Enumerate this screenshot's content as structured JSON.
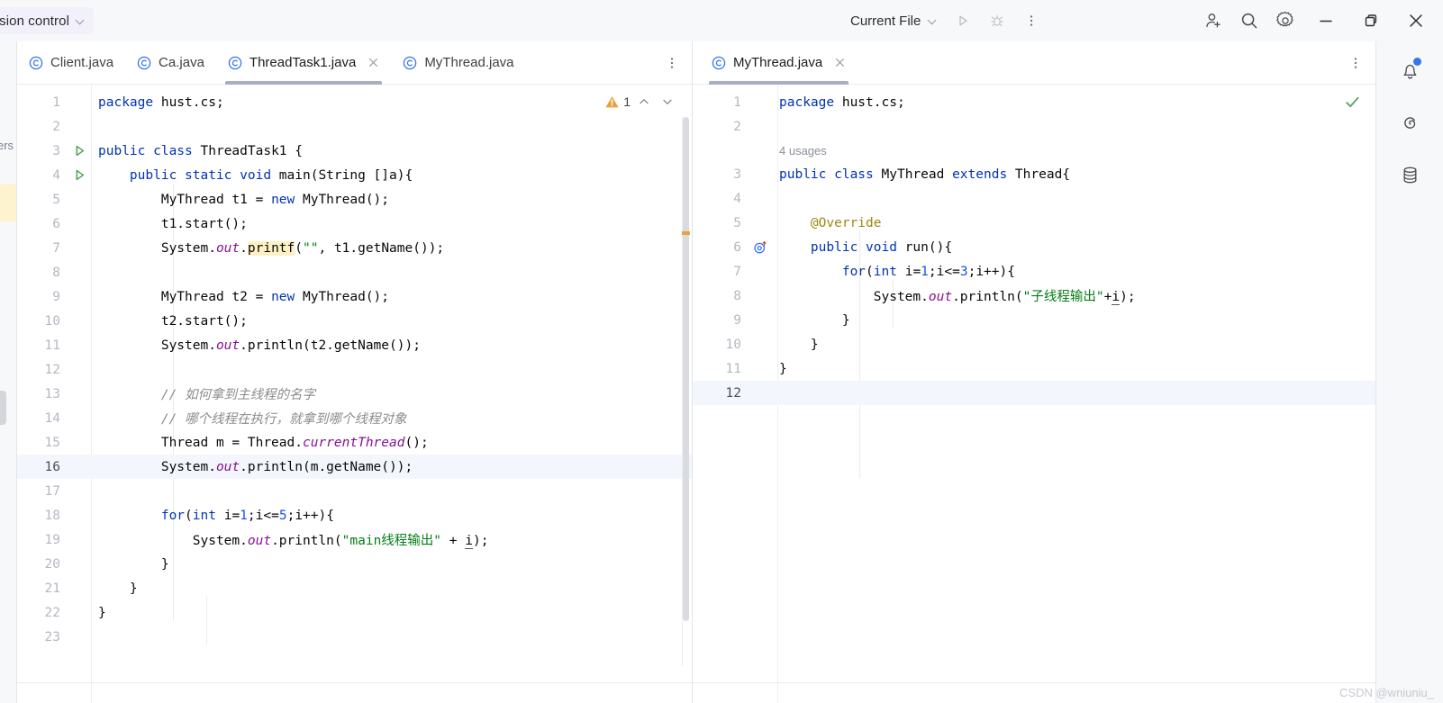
{
  "header": {
    "vcs_label": "rsion control",
    "vcs_chevron_icon": "chevron-down-icon",
    "run_config_label": "Current File",
    "run_config_chevron_icon": "chevron-down-icon",
    "run_icon": "run-play-icon",
    "debug_icon": "debug-bug-icon",
    "more_icon": "more-vertical-icon",
    "add_user_icon": "add-user-icon",
    "search_icon": "search-icon",
    "settings_icon": "gear-icon",
    "minimize_icon": "minimize-icon",
    "maximize_icon": "restore-icon",
    "close_icon": "close-icon"
  },
  "left_stripe": {
    "label": "ers",
    "marker_color": "#fdf3cf"
  },
  "right_stripe": {
    "items": [
      {
        "icon": "notifications-bell-icon",
        "badge": true
      },
      {
        "icon": "ai-assistant-spiral-icon",
        "badge": false
      },
      {
        "icon": "database-icon",
        "badge": false
      }
    ]
  },
  "left_pane": {
    "tabs": [
      {
        "label": "Client.java",
        "icon": "java-class-icon",
        "active": false,
        "closable": false
      },
      {
        "label": "Ca.java",
        "icon": "java-class-icon",
        "active": false,
        "closable": false
      },
      {
        "label": "ThreadTask1.java",
        "icon": "java-class-icon",
        "active": true,
        "closable": true
      },
      {
        "label": "MyThread.java",
        "icon": "java-class-icon",
        "active": false,
        "closable": false
      }
    ],
    "tab_overflow_icon": "more-vertical-icon",
    "inspection": {
      "warning_icon": "warning-triangle-icon",
      "count": "1",
      "prev_icon": "chevron-up-icon",
      "next_icon": "chevron-down-icon"
    },
    "current_line": 16,
    "lines": [
      {
        "n": 1,
        "gutter": "",
        "tokens": [
          {
            "t": "package ",
            "c": "kw"
          },
          {
            "t": "hust.cs;",
            "c": ""
          }
        ]
      },
      {
        "n": 2,
        "gutter": "",
        "tokens": []
      },
      {
        "n": 3,
        "gutter": "run-play-icon",
        "tokens": [
          {
            "t": "public class ",
            "c": "kw"
          },
          {
            "t": "ThreadTask1 {",
            "c": ""
          }
        ]
      },
      {
        "n": 4,
        "gutter": "run-play-icon",
        "tokens": [
          {
            "t": "    ",
            "c": ""
          },
          {
            "t": "public static void ",
            "c": "kw"
          },
          {
            "t": "main(String []a){",
            "c": ""
          }
        ]
      },
      {
        "n": 5,
        "gutter": "",
        "tokens": [
          {
            "t": "        MyThread t1 = ",
            "c": ""
          },
          {
            "t": "new ",
            "c": "kw"
          },
          {
            "t": "MyThread();",
            "c": ""
          }
        ]
      },
      {
        "n": 6,
        "gutter": "",
        "tokens": [
          {
            "t": "        t1.start();",
            "c": ""
          }
        ]
      },
      {
        "n": 7,
        "gutter": "",
        "tokens": [
          {
            "t": "        System.",
            "c": ""
          },
          {
            "t": "out",
            "c": "fld"
          },
          {
            "t": ".",
            "c": ""
          },
          {
            "t": "printf",
            "c": "hl"
          },
          {
            "t": "(",
            "c": ""
          },
          {
            "t": "\"\"",
            "c": "str"
          },
          {
            "t": ", t1.getName());",
            "c": ""
          }
        ]
      },
      {
        "n": 8,
        "gutter": "",
        "tokens": []
      },
      {
        "n": 9,
        "gutter": "",
        "tokens": [
          {
            "t": "        MyThread t2 = ",
            "c": ""
          },
          {
            "t": "new ",
            "c": "kw"
          },
          {
            "t": "MyThread();",
            "c": ""
          }
        ]
      },
      {
        "n": 10,
        "gutter": "",
        "tokens": [
          {
            "t": "        t2.start();",
            "c": ""
          }
        ]
      },
      {
        "n": 11,
        "gutter": "",
        "tokens": [
          {
            "t": "        System.",
            "c": ""
          },
          {
            "t": "out",
            "c": "fld"
          },
          {
            "t": ".println(t2.getName());",
            "c": ""
          }
        ]
      },
      {
        "n": 12,
        "gutter": "",
        "tokens": []
      },
      {
        "n": 13,
        "gutter": "",
        "tokens": [
          {
            "t": "        // 如何拿到主线程的名字",
            "c": "cmt"
          }
        ]
      },
      {
        "n": 14,
        "gutter": "",
        "tokens": [
          {
            "t": "        // 哪个线程在执行，就拿到哪个线程对象",
            "c": "cmt"
          }
        ]
      },
      {
        "n": 15,
        "gutter": "",
        "tokens": [
          {
            "t": "        Thread m = Thread.",
            "c": ""
          },
          {
            "t": "currentThread",
            "c": "fld"
          },
          {
            "t": "();",
            "c": ""
          }
        ]
      },
      {
        "n": 16,
        "gutter": "",
        "tokens": [
          {
            "t": "        System.",
            "c": ""
          },
          {
            "t": "out",
            "c": "fld"
          },
          {
            "t": ".println(m.getName());",
            "c": ""
          }
        ]
      },
      {
        "n": 17,
        "gutter": "",
        "tokens": []
      },
      {
        "n": 18,
        "gutter": "",
        "tokens": [
          {
            "t": "        ",
            "c": ""
          },
          {
            "t": "for",
            "c": "kw"
          },
          {
            "t": "(",
            "c": ""
          },
          {
            "t": "int ",
            "c": "kw"
          },
          {
            "t": "i",
            "c": "und"
          },
          {
            "t": "=",
            "c": ""
          },
          {
            "t": "1",
            "c": "num"
          },
          {
            "t": ";",
            "c": ""
          },
          {
            "t": "i",
            "c": "und"
          },
          {
            "t": "<=",
            "c": ""
          },
          {
            "t": "5",
            "c": "num"
          },
          {
            "t": ";",
            "c": ""
          },
          {
            "t": "i",
            "c": "und"
          },
          {
            "t": "++){",
            "c": ""
          }
        ]
      },
      {
        "n": 19,
        "gutter": "",
        "tokens": [
          {
            "t": "            System.",
            "c": ""
          },
          {
            "t": "out",
            "c": "fld"
          },
          {
            "t": ".println(",
            "c": ""
          },
          {
            "t": "\"main线程输出\"",
            "c": "str"
          },
          {
            "t": " + ",
            "c": ""
          },
          {
            "t": "i",
            "c": "und"
          },
          {
            "t": ");",
            "c": ""
          }
        ]
      },
      {
        "n": 20,
        "gutter": "",
        "tokens": [
          {
            "t": "        }",
            "c": ""
          }
        ]
      },
      {
        "n": 21,
        "gutter": "",
        "tokens": [
          {
            "t": "    }",
            "c": ""
          }
        ]
      },
      {
        "n": 22,
        "gutter": "",
        "tokens": [
          {
            "t": "}",
            "c": ""
          }
        ]
      },
      {
        "n": 23,
        "gutter": "",
        "tokens": []
      }
    ]
  },
  "right_pane": {
    "tabs": [
      {
        "label": "MyThread.java",
        "icon": "java-class-icon",
        "active": true,
        "closable": true
      }
    ],
    "tab_overflow_icon": "more-vertical-icon",
    "status_icon": "inspection-ok-check-icon",
    "usages_hint": "4 usages",
    "current_line": 12,
    "lines": [
      {
        "n": 1,
        "gutter": "",
        "tokens": [
          {
            "t": "package ",
            "c": "kw"
          },
          {
            "t": "hust.cs;",
            "c": ""
          }
        ]
      },
      {
        "n": 2,
        "gutter": "",
        "tokens": []
      },
      {
        "n": 3,
        "gutter": "",
        "tokens": [
          {
            "t": "public class ",
            "c": "kw"
          },
          {
            "t": "MyThread ",
            "c": ""
          },
          {
            "t": "extends ",
            "c": "kw"
          },
          {
            "t": "Thread{",
            "c": ""
          }
        ]
      },
      {
        "n": 4,
        "gutter": "",
        "tokens": []
      },
      {
        "n": 5,
        "gutter": "",
        "tokens": [
          {
            "t": "    ",
            "c": ""
          },
          {
            "t": "@Override",
            "c": "ann"
          }
        ]
      },
      {
        "n": 6,
        "gutter": "override-method-icon",
        "tokens": [
          {
            "t": "    ",
            "c": ""
          },
          {
            "t": "public void ",
            "c": "kw"
          },
          {
            "t": "run(){",
            "c": ""
          }
        ]
      },
      {
        "n": 7,
        "gutter": "",
        "tokens": [
          {
            "t": "        ",
            "c": ""
          },
          {
            "t": "for",
            "c": "kw"
          },
          {
            "t": "(",
            "c": ""
          },
          {
            "t": "int ",
            "c": "kw"
          },
          {
            "t": "i",
            "c": "und"
          },
          {
            "t": "=",
            "c": ""
          },
          {
            "t": "1",
            "c": "num"
          },
          {
            "t": ";",
            "c": ""
          },
          {
            "t": "i",
            "c": "und"
          },
          {
            "t": "<=",
            "c": ""
          },
          {
            "t": "3",
            "c": "num"
          },
          {
            "t": ";",
            "c": ""
          },
          {
            "t": "i",
            "c": "und"
          },
          {
            "t": "++){",
            "c": ""
          }
        ]
      },
      {
        "n": 8,
        "gutter": "",
        "tokens": [
          {
            "t": "            System.",
            "c": ""
          },
          {
            "t": "out",
            "c": "fld"
          },
          {
            "t": ".println(",
            "c": ""
          },
          {
            "t": "\"子线程输出\"",
            "c": "str"
          },
          {
            "t": "+",
            "c": ""
          },
          {
            "t": "i",
            "c": "und"
          },
          {
            "t": ");",
            "c": ""
          }
        ]
      },
      {
        "n": 9,
        "gutter": "",
        "tokens": [
          {
            "t": "        }",
            "c": ""
          }
        ]
      },
      {
        "n": 10,
        "gutter": "",
        "tokens": [
          {
            "t": "    }",
            "c": ""
          }
        ]
      },
      {
        "n": 11,
        "gutter": "",
        "tokens": [
          {
            "t": "}",
            "c": ""
          }
        ]
      },
      {
        "n": 12,
        "gutter": "",
        "tokens": []
      }
    ]
  },
  "watermark": "CSDN @wniuniu_",
  "colors": {
    "accent": "#3574f0",
    "warning": "#e8a33d",
    "ok": "#59a869",
    "keyword": "#0033b3",
    "string": "#067d17",
    "number": "#1750eb",
    "comment": "#8c8c8c",
    "field": "#871094",
    "annotation": "#9e880d",
    "highlight": "#fdf1c4",
    "tab_underline": "#a8aec4"
  }
}
